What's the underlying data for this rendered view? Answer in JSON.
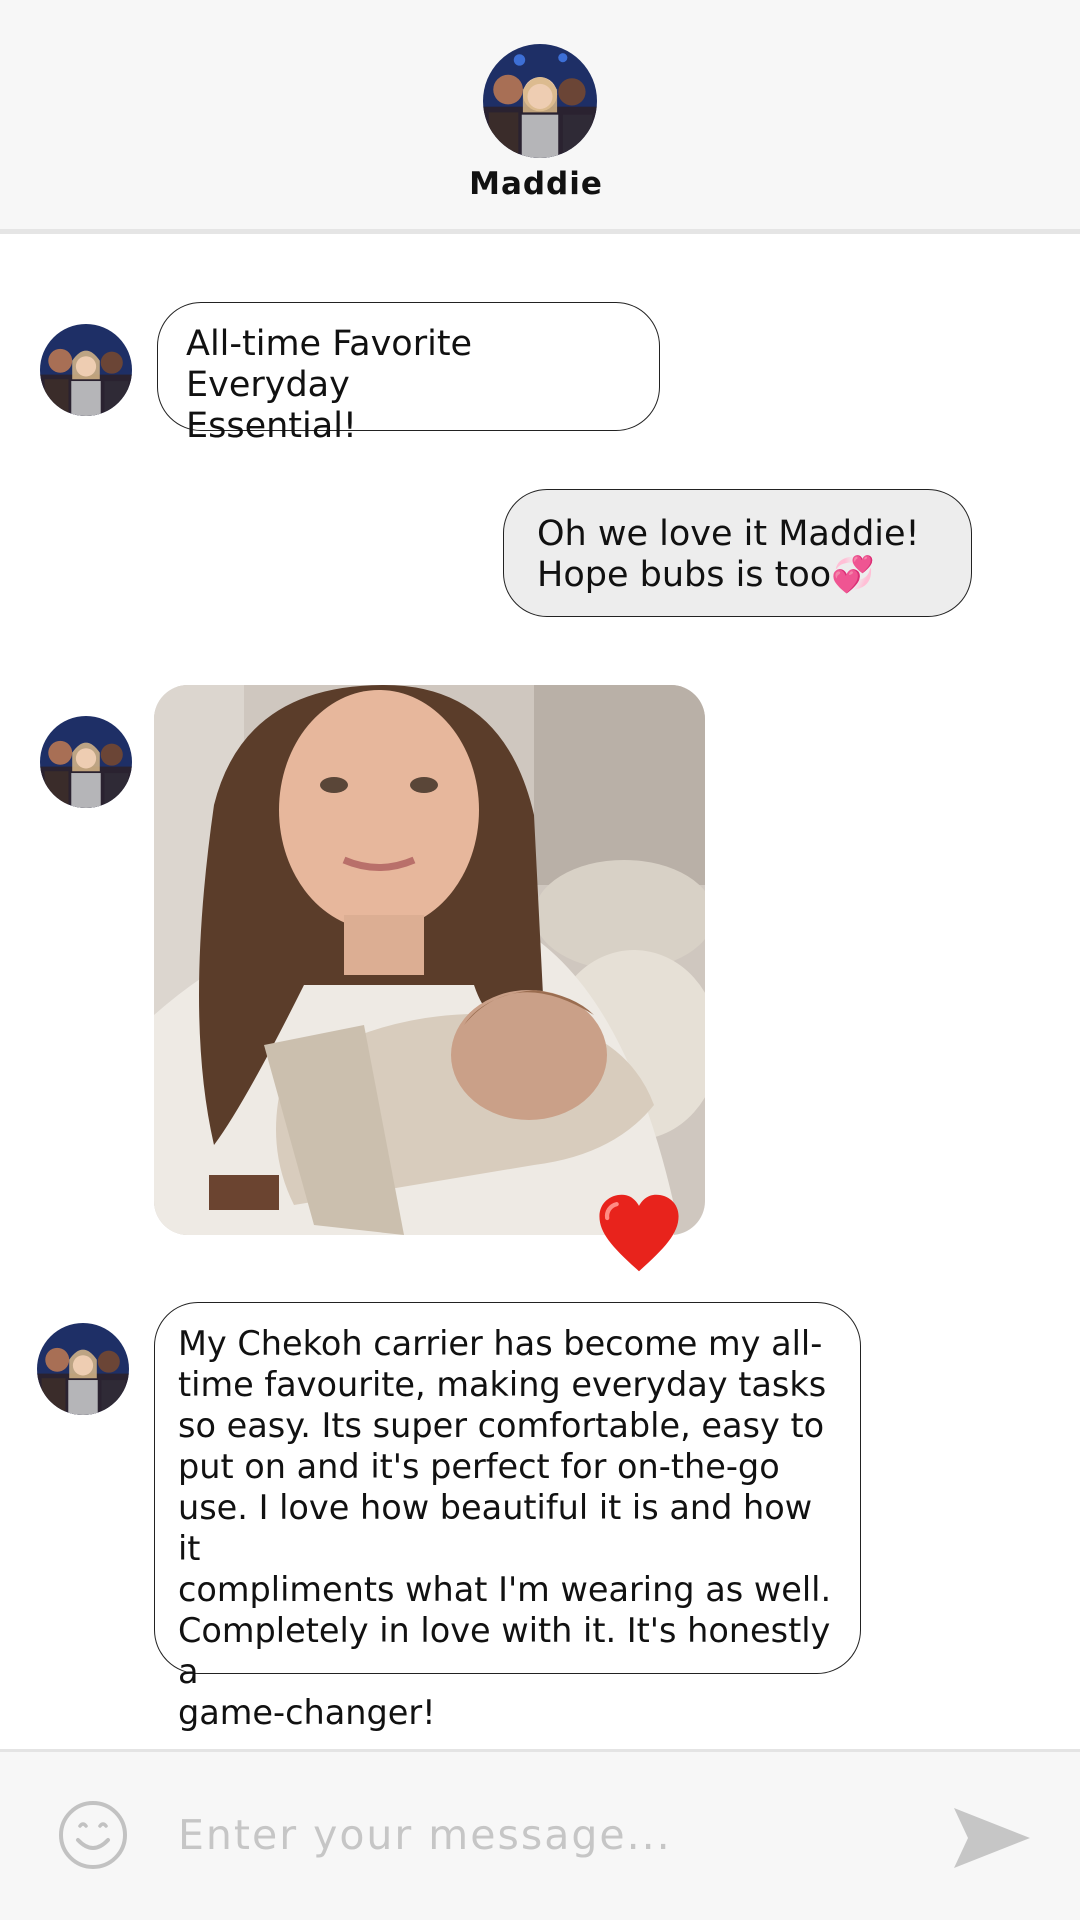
{
  "contact": {
    "name": "Maddie"
  },
  "messages": [
    {
      "direction": "incoming",
      "text": "All-time Favorite Everyday\nEssential!"
    },
    {
      "direction": "outgoing",
      "text": "Oh we love it Maddie!\nHope bubs is too💞"
    },
    {
      "direction": "incoming",
      "type": "photo",
      "reaction": "❤️"
    },
    {
      "direction": "incoming",
      "text": "My Chekoh carrier has become my all-\ntime favourite, making everyday tasks\nso easy. Its super comfortable, easy to\nput on and it's perfect for on-the-go\nuse. I love how beautiful it is and how it\ncompliments what I'm wearing as well.\nCompletely in love with it. It's honestly a\ngame-changer!"
    }
  ],
  "composer": {
    "placeholder": "Enter your message...",
    "value": "",
    "emoji_icon": "smiley-face-icon",
    "send_icon": "send-arrow-icon"
  },
  "colors": {
    "header_bg": "#f7f7f7",
    "outgoing_bubble": "#ededed",
    "reaction_heart": "#e8231c"
  }
}
